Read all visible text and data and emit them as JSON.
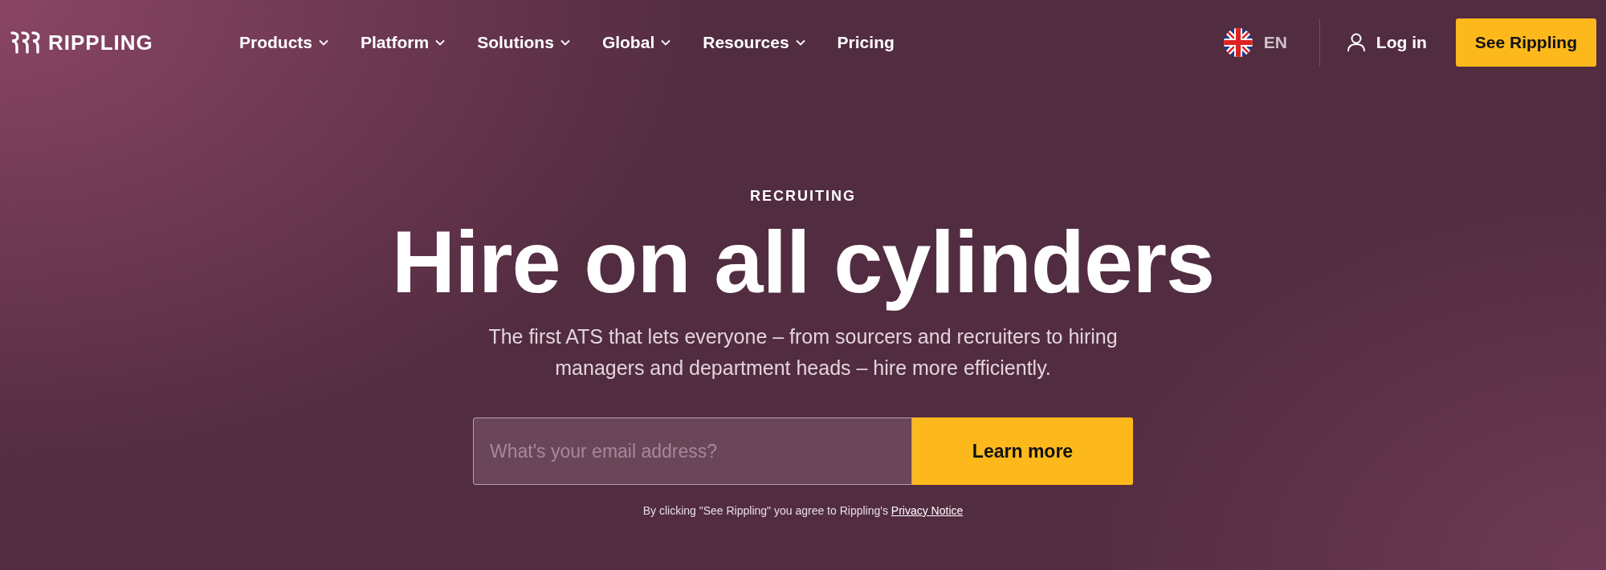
{
  "header": {
    "logo": "RIPPLING",
    "nav": [
      {
        "label": "Products",
        "has_menu": true
      },
      {
        "label": "Platform",
        "has_menu": true
      },
      {
        "label": "Solutions",
        "has_menu": true
      },
      {
        "label": "Global",
        "has_menu": true
      },
      {
        "label": "Resources",
        "has_menu": true
      },
      {
        "label": "Pricing",
        "has_menu": false
      }
    ],
    "language": "EN",
    "login": "Log in",
    "cta": "See Rippling"
  },
  "hero": {
    "eyebrow": "RECRUITING",
    "title": "Hire on all cylinders",
    "subtitle": "The first ATS that lets everyone – from sourcers and recruiters to hiring managers and department heads – hire more efficiently.",
    "email": {
      "placeholder": "What's your email address?"
    },
    "button": "Learn more",
    "disclaimer": "By clicking \"See Rippling\" you agree to Rippling's",
    "privacy_link": "Privacy Notice"
  }
}
